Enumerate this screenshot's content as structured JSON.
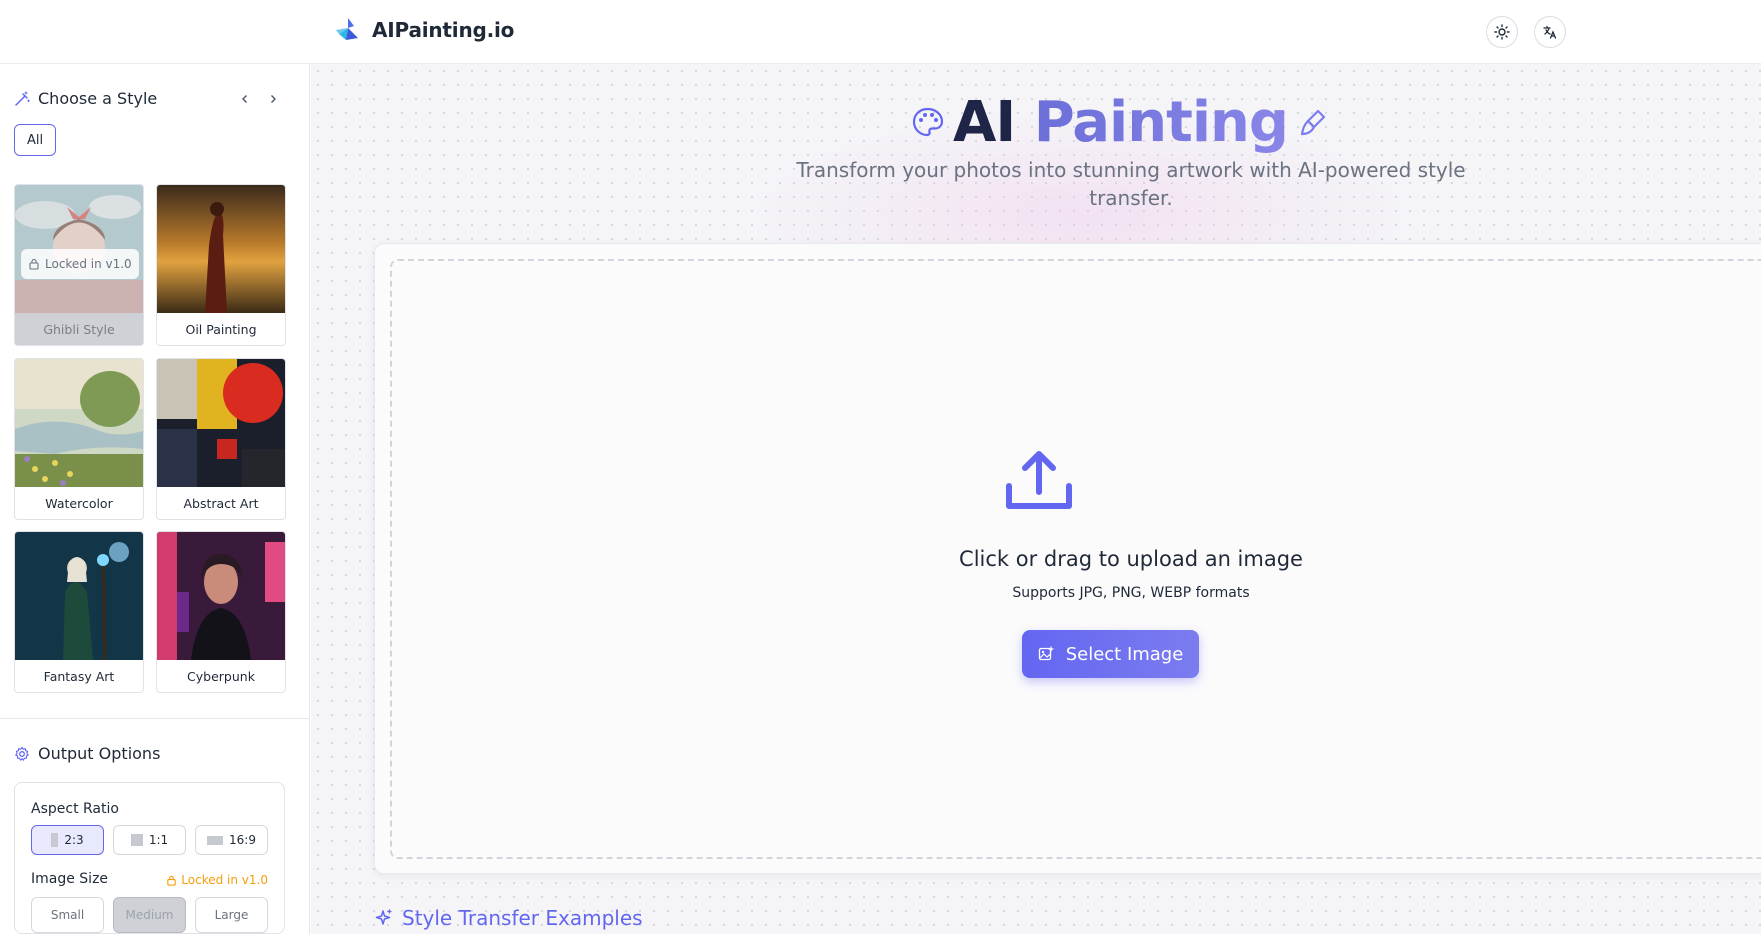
{
  "header": {
    "brand_name": "AIPainting.io",
    "theme_toggle_icon": "sun-icon",
    "language_icon": "translate-icon"
  },
  "sidebar": {
    "style_section": {
      "title": "Choose a Style",
      "filters": [
        {
          "label": "All",
          "active": true
        }
      ],
      "styles": [
        {
          "label": "Ghibli Style",
          "locked": true,
          "lock_text": "Locked in v1.0"
        },
        {
          "label": "Oil Painting",
          "locked": false
        },
        {
          "label": "Watercolor",
          "locked": false
        },
        {
          "label": "Abstract Art",
          "locked": false
        },
        {
          "label": "Fantasy Art",
          "locked": false
        },
        {
          "label": "Cyberpunk",
          "locked": false
        }
      ]
    },
    "output_section": {
      "title": "Output Options",
      "aspect_ratio": {
        "label": "Aspect Ratio",
        "options": [
          {
            "label": "2:3",
            "selected": true
          },
          {
            "label": "1:1",
            "selected": false
          },
          {
            "label": "16:9",
            "selected": false
          }
        ]
      },
      "image_size": {
        "label": "Image Size",
        "lock_note": "Locked in v1.0",
        "options": [
          {
            "label": "Small",
            "selected": false
          },
          {
            "label": "Medium",
            "selected": true
          },
          {
            "label": "Large",
            "selected": false
          }
        ]
      }
    }
  },
  "main": {
    "hero": {
      "title_part1": "AI",
      "title_part2": "Painting",
      "subtitle": "Transform your photos into stunning artwork with AI-powered style transfer."
    },
    "upload": {
      "title": "Click or drag to upload an image",
      "formats": "Supports JPG, PNG, WEBP formats",
      "button_label": "Select Image"
    },
    "examples_title": "Style Transfer Examples"
  },
  "colors": {
    "accent": "#6366f1",
    "warning": "#f59e0b",
    "hero_dark": "#1f2547"
  }
}
